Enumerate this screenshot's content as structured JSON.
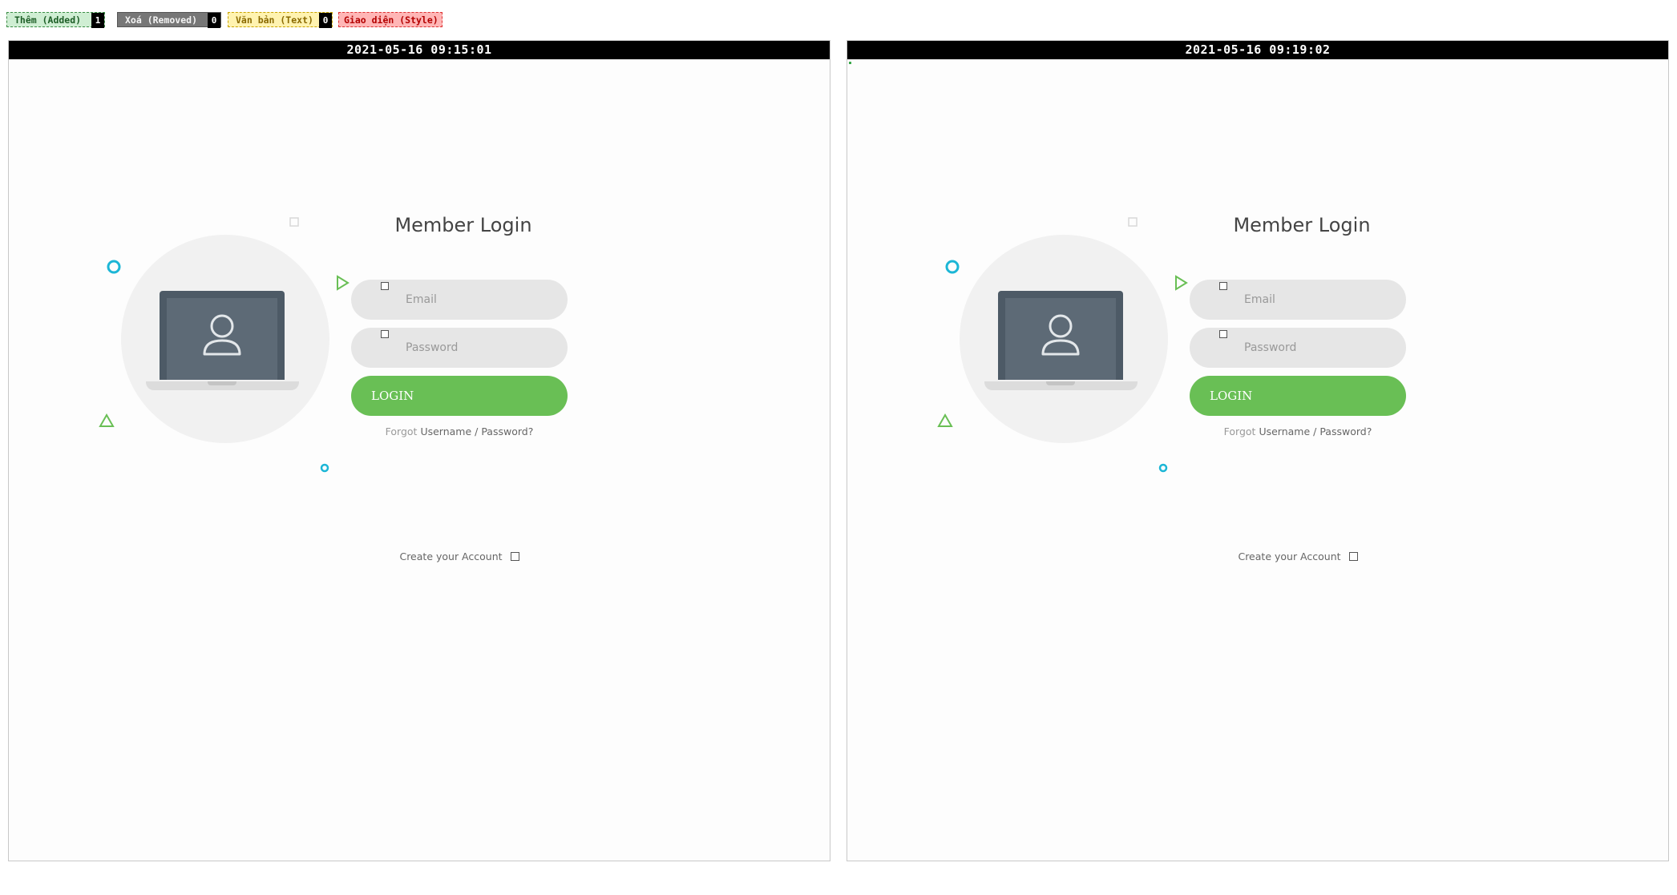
{
  "legend": {
    "added": {
      "label": "Thêm (Added)",
      "count": "1",
      "color": "#cfeed3"
    },
    "removed": {
      "label": "Xoá (Removed)",
      "count": "0",
      "color": "#777777"
    },
    "text": {
      "label": "Văn bản (Text)",
      "count": "0",
      "color": "#fff3b0"
    },
    "style": {
      "label": "Giao diện (Style)",
      "color": "#ffb6b6"
    }
  },
  "panels": {
    "before": {
      "timestamp": "2021-05-16 09:15:01"
    },
    "after": {
      "timestamp": "2021-05-16 09:19:02"
    }
  },
  "login": {
    "title": "Member Login",
    "email_placeholder": "Email",
    "password_placeholder": "Password",
    "login_button": "LOGIN",
    "forgot_prefix": "Forgot",
    "forgot_link": "Username / Password?",
    "create_account": "Create your Account"
  },
  "colors": {
    "accent_green": "#69bf55",
    "deco_cyan": "#1cb6d6",
    "laptop": "#4d5a66"
  },
  "icons": [
    "user-icon",
    "laptop-icon",
    "circle-deco",
    "triangle-deco",
    "square-deco",
    "checkbox-icon"
  ]
}
